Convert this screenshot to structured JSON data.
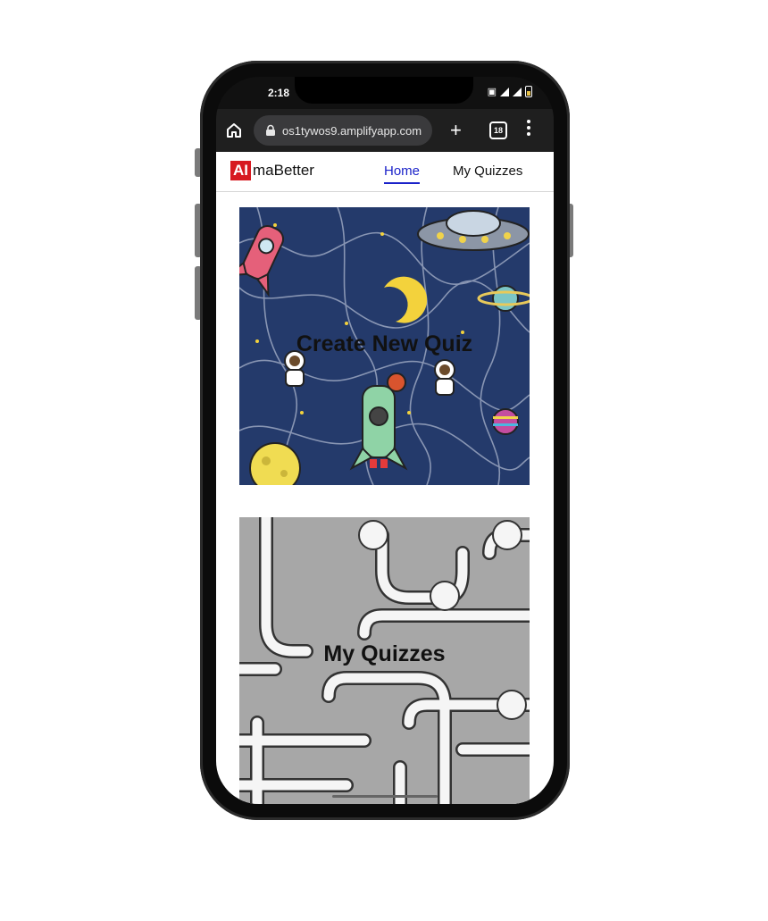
{
  "status_bar": {
    "time": "2:18"
  },
  "browser": {
    "url": "os1tywos9.amplifyapp.com",
    "tab_count": "18"
  },
  "app": {
    "logo_highlight": "AI",
    "logo_rest": "maBetter",
    "nav": {
      "home": "Home",
      "my_quizzes": "My Quizzes"
    }
  },
  "cards": {
    "create": {
      "label": "Create New Quiz"
    },
    "my": {
      "label": "My Quizzes"
    }
  },
  "colors": {
    "logo_red": "#d71920",
    "active_nav": "#1a22c9",
    "space_bg": "#243a6b",
    "rope_bg": "#a7a7a7"
  },
  "icons": [
    "home-icon",
    "lock-icon",
    "plus-icon",
    "tab-switcher-icon",
    "menu-dots-icon",
    "signal-icon",
    "battery-icon"
  ]
}
